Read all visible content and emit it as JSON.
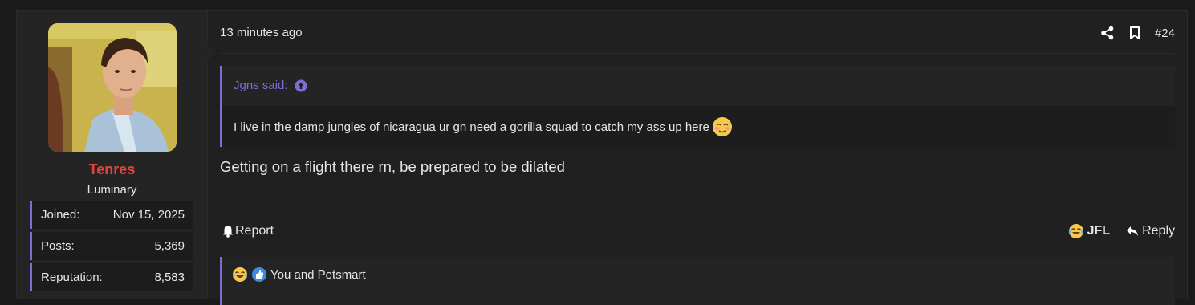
{
  "user": {
    "name": "Tenres",
    "title": "Luminary",
    "stats": [
      {
        "label": "Joined:",
        "value": "Nov 15, 2025"
      },
      {
        "label": "Posts:",
        "value": "5,369"
      },
      {
        "label": "Reputation:",
        "value": "8,583"
      }
    ]
  },
  "post": {
    "time": "13 minutes ago",
    "number": "#24",
    "quote": {
      "author": "Jgns said:",
      "text": "I live in the damp jungles of nicaragua ur gn need a gorilla squad to catch my ass up here"
    },
    "body": "Getting on a flight there rn, be prepared to be dilated"
  },
  "footer": {
    "report_label": "Report",
    "reaction_label": "JFL",
    "reply_label": "Reply"
  },
  "reactions": {
    "text": "You and Petsmart"
  },
  "colors": {
    "accent": "#7a6fd6",
    "username": "#e0463f",
    "background": "#1a1a1a",
    "panel": "#202020"
  },
  "icons": {
    "share": "share-icon",
    "bookmark": "bookmark-icon",
    "quote_up": "arrow-up-circle-icon",
    "emoji": "blushing-face-icon",
    "report": "bell-icon",
    "jfl": "laughing-crying-face-icon",
    "reply": "reply-arrow-icon",
    "like": "thumbs-up-icon"
  }
}
